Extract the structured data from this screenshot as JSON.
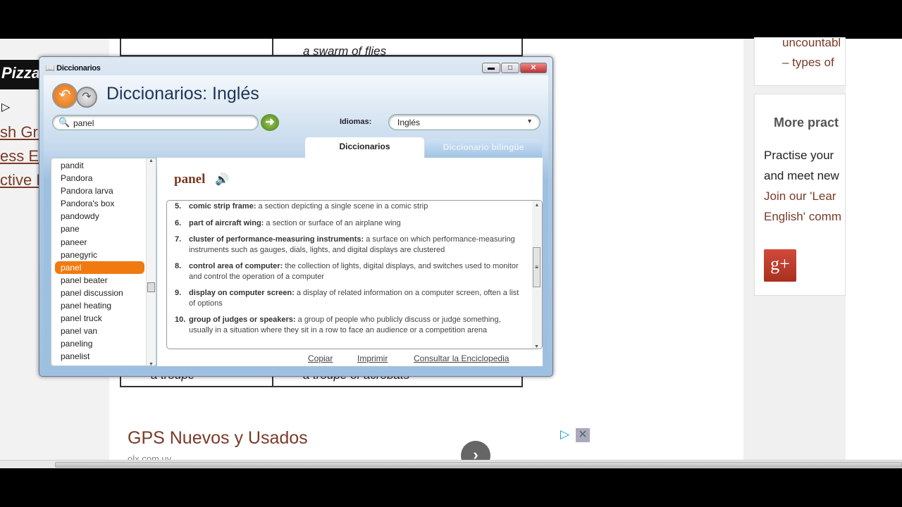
{
  "background": {
    "left_banner": "Pizza",
    "left_links": [
      "sh Gra",
      "ess E",
      "ctive N"
    ],
    "table_top_cell": "a swarm of flies",
    "table_bottom_left": "a troupe",
    "table_bottom_right": "a troupe of acrobats",
    "right_card1": [
      "uncountabl",
      "– types of"
    ],
    "right_card2_title": "More pract",
    "right_card2_text": [
      "Practise your",
      "and meet new"
    ],
    "right_card2_link": [
      "Join our 'Lear",
      "English' comm"
    ],
    "gplus_label": "g+",
    "ad_title": "GPS Nuevos y Usados",
    "ad_url": "olx.com.uy"
  },
  "dialog": {
    "window_title": "Diccionarios",
    "header_title": "Diccionarios: Inglés",
    "search_value": "panel",
    "languages_label": "Idiomas:",
    "language_selected": "Inglés",
    "tabs": [
      {
        "label": "Diccionarios",
        "active": true
      },
      {
        "label": "Diccionario bilingüe",
        "active": false
      }
    ],
    "word_list": [
      "pandit",
      "Pandora",
      "Pandora larva",
      "Pandora's box",
      "pandowdy",
      "pane",
      "paneer",
      "panegyric",
      "panel",
      "panel beater",
      "panel discussion",
      "panel heating",
      "panel truck",
      "panel van",
      "paneling",
      "panelist"
    ],
    "selected_word": "panel",
    "headword": "panel",
    "definitions": [
      {
        "num": "5.",
        "term": "comic strip frame:",
        "text": "a section depicting a single scene in a comic strip"
      },
      {
        "num": "6.",
        "term": "part of aircraft wing:",
        "text": "a section or surface of an airplane wing"
      },
      {
        "num": "7.",
        "term": "cluster of performance-measuring instruments:",
        "text": "a surface on which performance-measuring instruments such as gauges, dials, lights, and digital displays are clustered"
      },
      {
        "num": "8.",
        "term": "control area of computer:",
        "text": "the collection of lights, digital displays, and switches used to monitor and control the operation of a computer"
      },
      {
        "num": "9.",
        "term": "display on computer screen:",
        "text": "a display of related information on a computer screen, often a list of options"
      },
      {
        "num": "10.",
        "term": "group of judges or speakers:",
        "text": "a group of people who publicly discuss or judge something, usually in a situation where they sit in a row to face an audience or a competition arena"
      }
    ],
    "actions": [
      "Copiar",
      "Imprimir",
      "Consultar la Enciclopedia"
    ],
    "accent": "#f07a10"
  }
}
